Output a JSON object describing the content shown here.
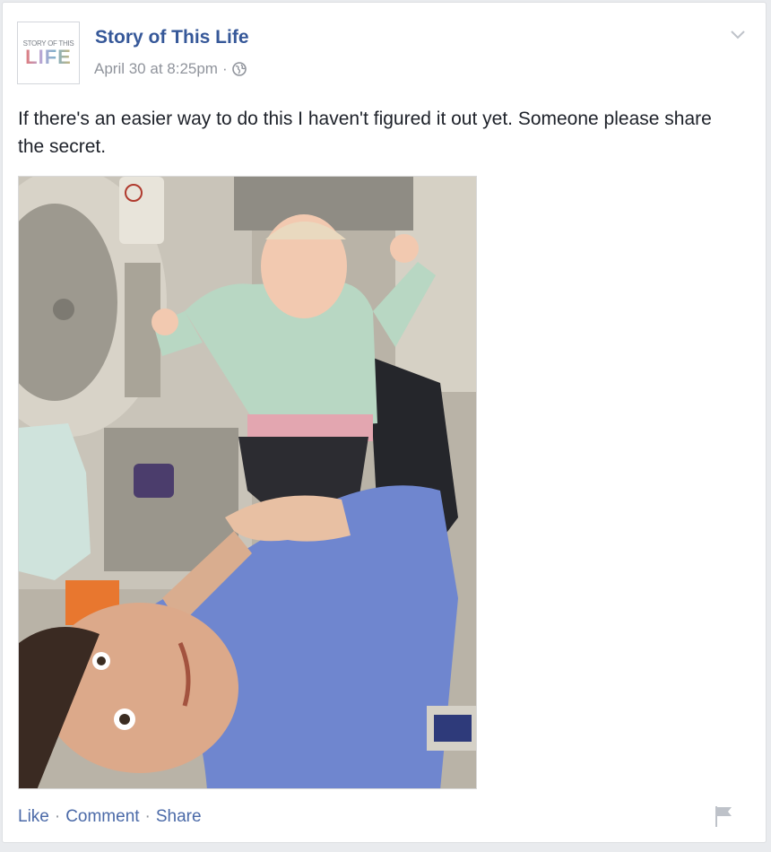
{
  "post": {
    "page_name": "Story of This Life",
    "avatar": {
      "top_text": "STORY OF THIS",
      "big_text": "LIFE"
    },
    "timestamp": "April 30 at 8:25pm",
    "separator": "·",
    "privacy_icon": "globe-icon",
    "menu_icon": "chevron-down-icon",
    "text": "If there's an easier way to do this I haven't figured it out yet. Someone please share the secret.",
    "photo_icon": "photo"
  },
  "actions": {
    "like": "Like",
    "comment": "Comment",
    "share": "Share",
    "sep": "·",
    "flag_icon": "flag-icon"
  },
  "colors": {
    "link": "#365899",
    "action": "#4b6aa8",
    "meta": "#90949c",
    "background": "#e9ebee"
  }
}
